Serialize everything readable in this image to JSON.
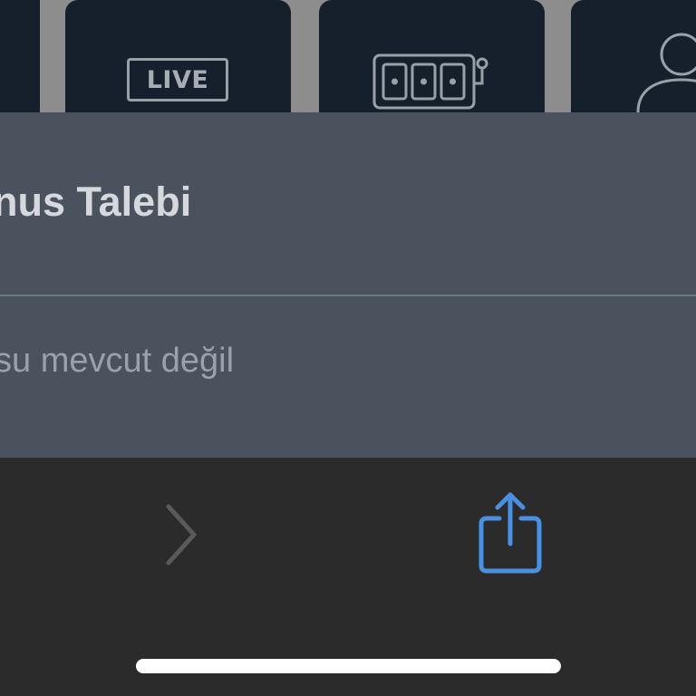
{
  "categories": {
    "tiles": [
      {
        "icon": "partial-tile"
      },
      {
        "icon": "live-icon",
        "label": "LIVE"
      },
      {
        "icon": "slot-machine-icon"
      },
      {
        "icon": "user-icon"
      }
    ]
  },
  "sheet": {
    "title": "nus Talebi",
    "message": "su mevcut değil"
  },
  "toolbar": {
    "forward_icon": "chevron-right-icon",
    "share_icon": "share-icon",
    "accent_color": "#4a90e2",
    "disabled_color": "#5a5a5a"
  },
  "colors": {
    "tile_bg": "#16202d",
    "sheet_bg": "#4a525d",
    "toolbar_bg": "#2b2b2b"
  }
}
